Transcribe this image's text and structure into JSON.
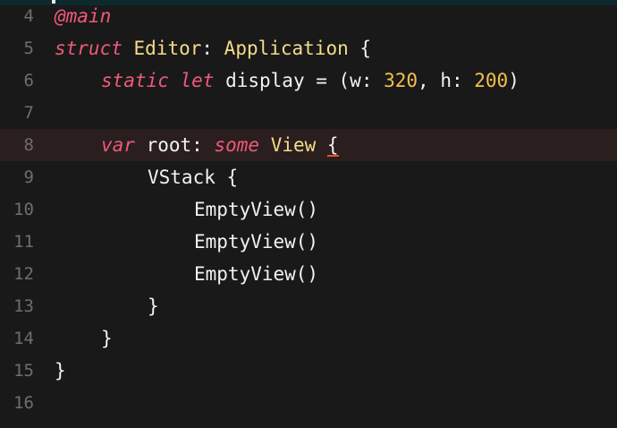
{
  "editor": {
    "current_line": "8",
    "lines": [
      {
        "number": "4",
        "tokens": [
          {
            "t": "@main",
            "c": "kw"
          }
        ]
      },
      {
        "number": "5",
        "tokens": [
          {
            "t": "struct",
            "c": "kw"
          },
          {
            "t": " ",
            "c": "plain"
          },
          {
            "t": "Editor",
            "c": "type"
          },
          {
            "t": ": ",
            "c": "plain"
          },
          {
            "t": "Application",
            "c": "type"
          },
          {
            "t": " {",
            "c": "plain"
          }
        ]
      },
      {
        "number": "6",
        "tokens": [
          {
            "t": "static",
            "c": "kw"
          },
          {
            "t": " ",
            "c": "plain"
          },
          {
            "t": "let",
            "c": "kw"
          },
          {
            "t": " display = (w: ",
            "c": "plain"
          },
          {
            "t": "320",
            "c": "num"
          },
          {
            "t": ", h: ",
            "c": "plain"
          },
          {
            "t": "200",
            "c": "num"
          },
          {
            "t": ")",
            "c": "plain"
          }
        ]
      },
      {
        "number": "7",
        "tokens": []
      },
      {
        "number": "8",
        "tokens": [
          {
            "t": "var",
            "c": "kw"
          },
          {
            "t": " root: ",
            "c": "plain"
          },
          {
            "t": "some",
            "c": "kw"
          },
          {
            "t": " ",
            "c": "plain"
          },
          {
            "t": "View",
            "c": "type"
          },
          {
            "t": " ",
            "c": "plain"
          },
          {
            "t": "{",
            "c": "caret"
          }
        ]
      },
      {
        "number": "9",
        "tokens": [
          {
            "t": "VStack {",
            "c": "plain"
          }
        ]
      },
      {
        "number": "10",
        "tokens": [
          {
            "t": "EmptyView()",
            "c": "plain"
          }
        ]
      },
      {
        "number": "11",
        "tokens": [
          {
            "t": "EmptyView()",
            "c": "plain"
          }
        ]
      },
      {
        "number": "12",
        "tokens": [
          {
            "t": "EmptyView()",
            "c": "plain"
          }
        ]
      },
      {
        "number": "13",
        "tokens": [
          {
            "t": "}",
            "c": "plain"
          }
        ]
      },
      {
        "number": "14",
        "tokens": [
          {
            "t": "}",
            "c": "plain"
          }
        ]
      },
      {
        "number": "15",
        "tokens": [
          {
            "t": "}",
            "c": "plain"
          }
        ]
      },
      {
        "number": "16",
        "tokens": []
      }
    ]
  },
  "colors": {
    "background": "#191919",
    "keyword": "#ee5a7a",
    "type": "#f5dc8a",
    "number": "#f5c04a",
    "text": "#f2f2f2",
    "line_number": "#6e6e6e",
    "current_line_bg": "#2a1e1e",
    "caret_underline": "#e8542f"
  }
}
